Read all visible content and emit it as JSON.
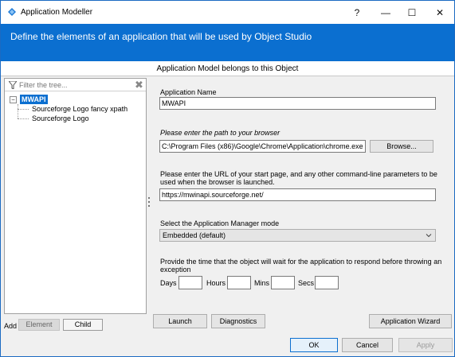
{
  "window": {
    "title": "Application Modeller",
    "help_label": "?",
    "minimize_label": "—",
    "maximize_label": "☐",
    "close_label": "✕"
  },
  "banner": {
    "text": "Define the elements of an application that will be used by Object Studio"
  },
  "subheader": {
    "text": "Application Model belongs to this Object"
  },
  "tree": {
    "filter_placeholder": "Filter the tree...",
    "clear_label": "✖",
    "toggle_label": "⊟",
    "root_label": "MWAPI",
    "children": [
      "Sourceforge Logo fancy xpath",
      "Sourceforge Logo"
    ]
  },
  "add_bar": {
    "add_label": "Add",
    "element_label": "Element",
    "child_label": "Child"
  },
  "form": {
    "app_name_label": "Application Name",
    "app_name_value": "MWAPI",
    "browser_path_label": "Please enter the path to your browser",
    "browser_path_value": "C:\\Program Files (x86)\\Google\\Chrome\\Application\\chrome.exe",
    "browse_label": "Browse...",
    "url_label_line1": "Please enter the URL of your start page, and any other command-line parameters to be",
    "url_label_line2": "used when the browser is launched.",
    "url_value": "https://mwinapi.sourceforge.net/",
    "mode_label": "Select the Application Manager mode",
    "mode_value": "Embedded (default)",
    "wait_label_line1": "Provide the time that the object will wait for the application to respond before throwing an",
    "wait_label_line2": "exception",
    "days_label": "Days",
    "hours_label": "Hours",
    "mins_label": "Mins",
    "secs_label": "Secs"
  },
  "actions": {
    "launch_label": "Launch",
    "diagnostics_label": "Diagnostics",
    "wizard_label": "Application Wizard"
  },
  "footer": {
    "ok_label": "OK",
    "cancel_label": "Cancel",
    "apply_label": "Apply"
  },
  "colors": {
    "accent": "#0b6fd0",
    "window_border": "#1b6ac2"
  }
}
